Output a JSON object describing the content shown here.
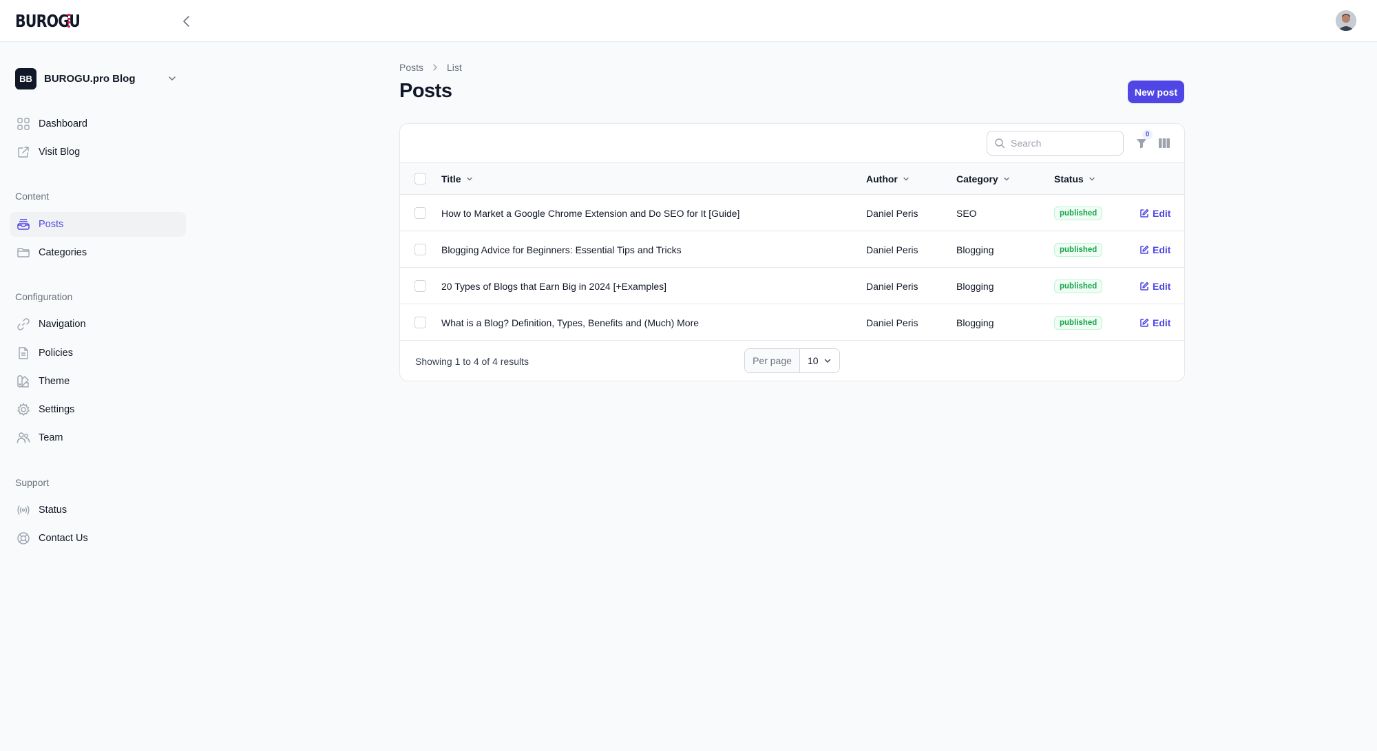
{
  "app": {
    "logo_text": "BUROGU",
    "avatar_icon": "user-avatar"
  },
  "colors": {
    "accent": "#4f46e5",
    "success": "#16a34a",
    "logo_accent": "#e11d48"
  },
  "sidebar": {
    "tenant": {
      "initials": "BB",
      "name": "BUROGU.pro Blog"
    },
    "top_items": [
      {
        "label": "Dashboard",
        "icon": "grid-icon"
      },
      {
        "label": "Visit Blog",
        "icon": "external-link-icon"
      }
    ],
    "groups": [
      {
        "label": "Content",
        "items": [
          {
            "label": "Posts",
            "icon": "inbox-icon",
            "active": true
          },
          {
            "label": "Categories",
            "icon": "folder-icon"
          }
        ]
      },
      {
        "label": "Configuration",
        "items": [
          {
            "label": "Navigation",
            "icon": "link-icon"
          },
          {
            "label": "Policies",
            "icon": "document-icon"
          },
          {
            "label": "Theme",
            "icon": "swatch-icon"
          },
          {
            "label": "Settings",
            "icon": "gear-icon"
          },
          {
            "label": "Team",
            "icon": "users-icon"
          }
        ]
      },
      {
        "label": "Support",
        "items": [
          {
            "label": "Status",
            "icon": "signal-icon"
          },
          {
            "label": "Contact Us",
            "icon": "lifebuoy-icon"
          }
        ]
      }
    ]
  },
  "breadcrumb": {
    "items": [
      "Posts",
      "List"
    ]
  },
  "page": {
    "title": "Posts",
    "new_button": "New post"
  },
  "table": {
    "search_placeholder": "Search",
    "filter_count": "0",
    "columns": [
      "Title",
      "Author",
      "Category",
      "Status"
    ],
    "rows": [
      {
        "title": "How to Market a Google Chrome Extension and Do SEO for It [Guide]",
        "author": "Daniel Peris",
        "category": "SEO",
        "status": "published",
        "action": "Edit"
      },
      {
        "title": "Blogging Advice for Beginners: Essential Tips and Tricks",
        "author": "Daniel Peris",
        "category": "Blogging",
        "status": "published",
        "action": "Edit"
      },
      {
        "title": "20 Types of Blogs that Earn Big in 2024 [+Examples]",
        "author": "Daniel Peris",
        "category": "Blogging",
        "status": "published",
        "action": "Edit"
      },
      {
        "title": "What is a Blog? Definition, Types, Benefits and (Much) More",
        "author": "Daniel Peris",
        "category": "Blogging",
        "status": "published",
        "action": "Edit"
      }
    ],
    "footer": {
      "showing": "Showing 1 to 4 of 4 results",
      "per_page_label": "Per page",
      "per_page_value": "10"
    }
  }
}
